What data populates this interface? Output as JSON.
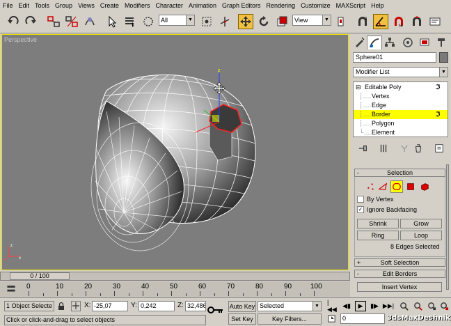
{
  "menubar": {
    "items": [
      "File",
      "Edit",
      "Tools",
      "Group",
      "Views",
      "Create",
      "Modifiers",
      "Character",
      "Animation",
      "Graph Editors",
      "Rendering",
      "Customize",
      "MAXScript",
      "Help"
    ]
  },
  "toolbar": {
    "selection_filter": "All",
    "ref_coord": "View"
  },
  "viewport": {
    "label": "Perspective"
  },
  "command_panel": {
    "object_name": "Sphere01",
    "modifier_list": "Modifier List",
    "stack": {
      "root": "Editable Poly",
      "items": [
        "Vertex",
        "Edge",
        "Border",
        "Polygon",
        "Element"
      ],
      "selected": "Border"
    },
    "selection_rollout": {
      "title": "Selection",
      "by_vertex": "By Vertex",
      "ignore_backfacing": "Ignore Backfacing",
      "by_vertex_checked": false,
      "ignore_backfacing_checked": true,
      "shrink": "Shrink",
      "grow": "Grow",
      "ring": "Ring",
      "loop": "Loop",
      "info": "8 Edges Selected"
    },
    "soft_selection_title": "Soft Selection",
    "edit_borders_title": "Edit Borders",
    "insert_vertex": "Insert Vertex"
  },
  "timeline": {
    "slider": "0 / 100",
    "ticks": [
      "0",
      "10",
      "20",
      "30",
      "40",
      "50",
      "60",
      "70",
      "80",
      "90",
      "100"
    ]
  },
  "status": {
    "selection_count": "1 Object Selecte",
    "x_label": "X:",
    "x_value": "-25,07",
    "y_label": "Y:",
    "y_value": "0,242",
    "z_label": "Z:",
    "z_value": "32,486",
    "prompt": "Click or click-and-drag to select objects",
    "auto_key": "Auto Key",
    "set_key": "Set Key",
    "key_mode": "Selected",
    "key_filters": "Key Filters...",
    "frame": "0"
  },
  "watermark": "3dsMaxDeshnik",
  "colors": {
    "viewport_bg": "#7d7d7d",
    "highlight": "#ffff00",
    "active_tool": "#f0c040",
    "ui_gray": "#d4d0c8"
  }
}
